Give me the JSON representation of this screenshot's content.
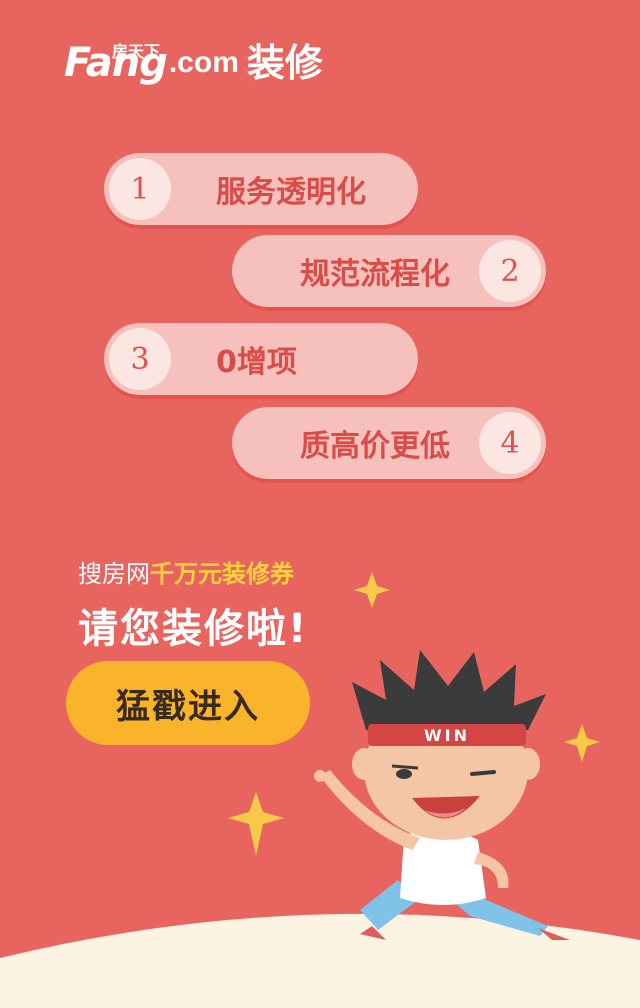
{
  "logo": {
    "brand": "Fang",
    "subtitle": "房天下",
    "domain": ".com",
    "product": "装修"
  },
  "features": [
    {
      "number": "1",
      "text": "服务透明化"
    },
    {
      "number": "2",
      "text": "规范流程化"
    },
    {
      "number": "3",
      "text": "0增项"
    },
    {
      "number": "4",
      "text": "质高价更低"
    }
  ],
  "promo": {
    "prefix": "搜房网",
    "highlight": "千万元装修券",
    "headline": "请您装修啦!"
  },
  "cta": {
    "label": "猛戳进入"
  },
  "mascot": {
    "headband_text": "WIN"
  },
  "colors": {
    "background": "#e8655f",
    "pill": "#f6c0bd",
    "accent_yellow": "#f9b42c",
    "highlight": "#ffd23c"
  }
}
